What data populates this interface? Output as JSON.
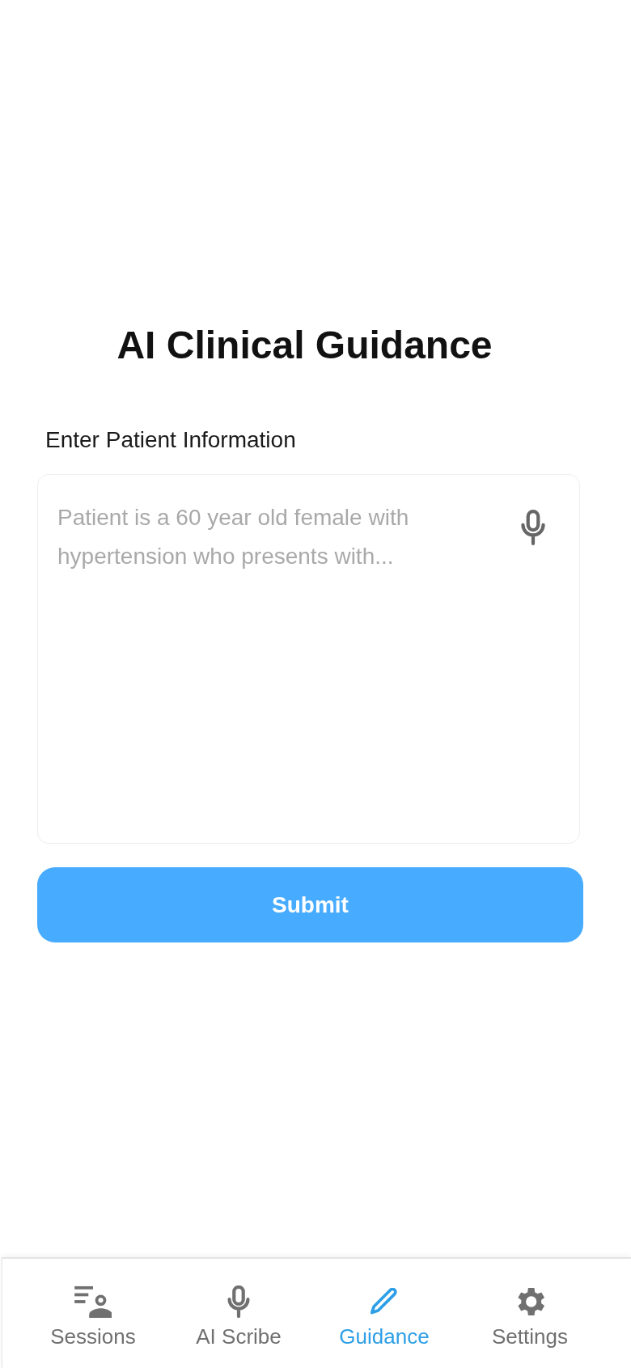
{
  "screen": {
    "title": "AI Clinical Guidance"
  },
  "form": {
    "label": "Enter Patient Information",
    "patient_info": {
      "placeholder": "Patient is a 60 year old female with hypertension who presents with..."
    },
    "submit": {
      "label": "Submit"
    }
  },
  "tab_bar": {
    "tabs": [
      {
        "kind": "sessions",
        "label": "Sessions",
        "selected": false
      },
      {
        "kind": "scribe",
        "label": "AI Scribe",
        "selected": false
      },
      {
        "kind": "guidance",
        "label": "Guidance",
        "selected": true
      },
      {
        "kind": "settings",
        "label": "Settings",
        "selected": false
      }
    ]
  }
}
